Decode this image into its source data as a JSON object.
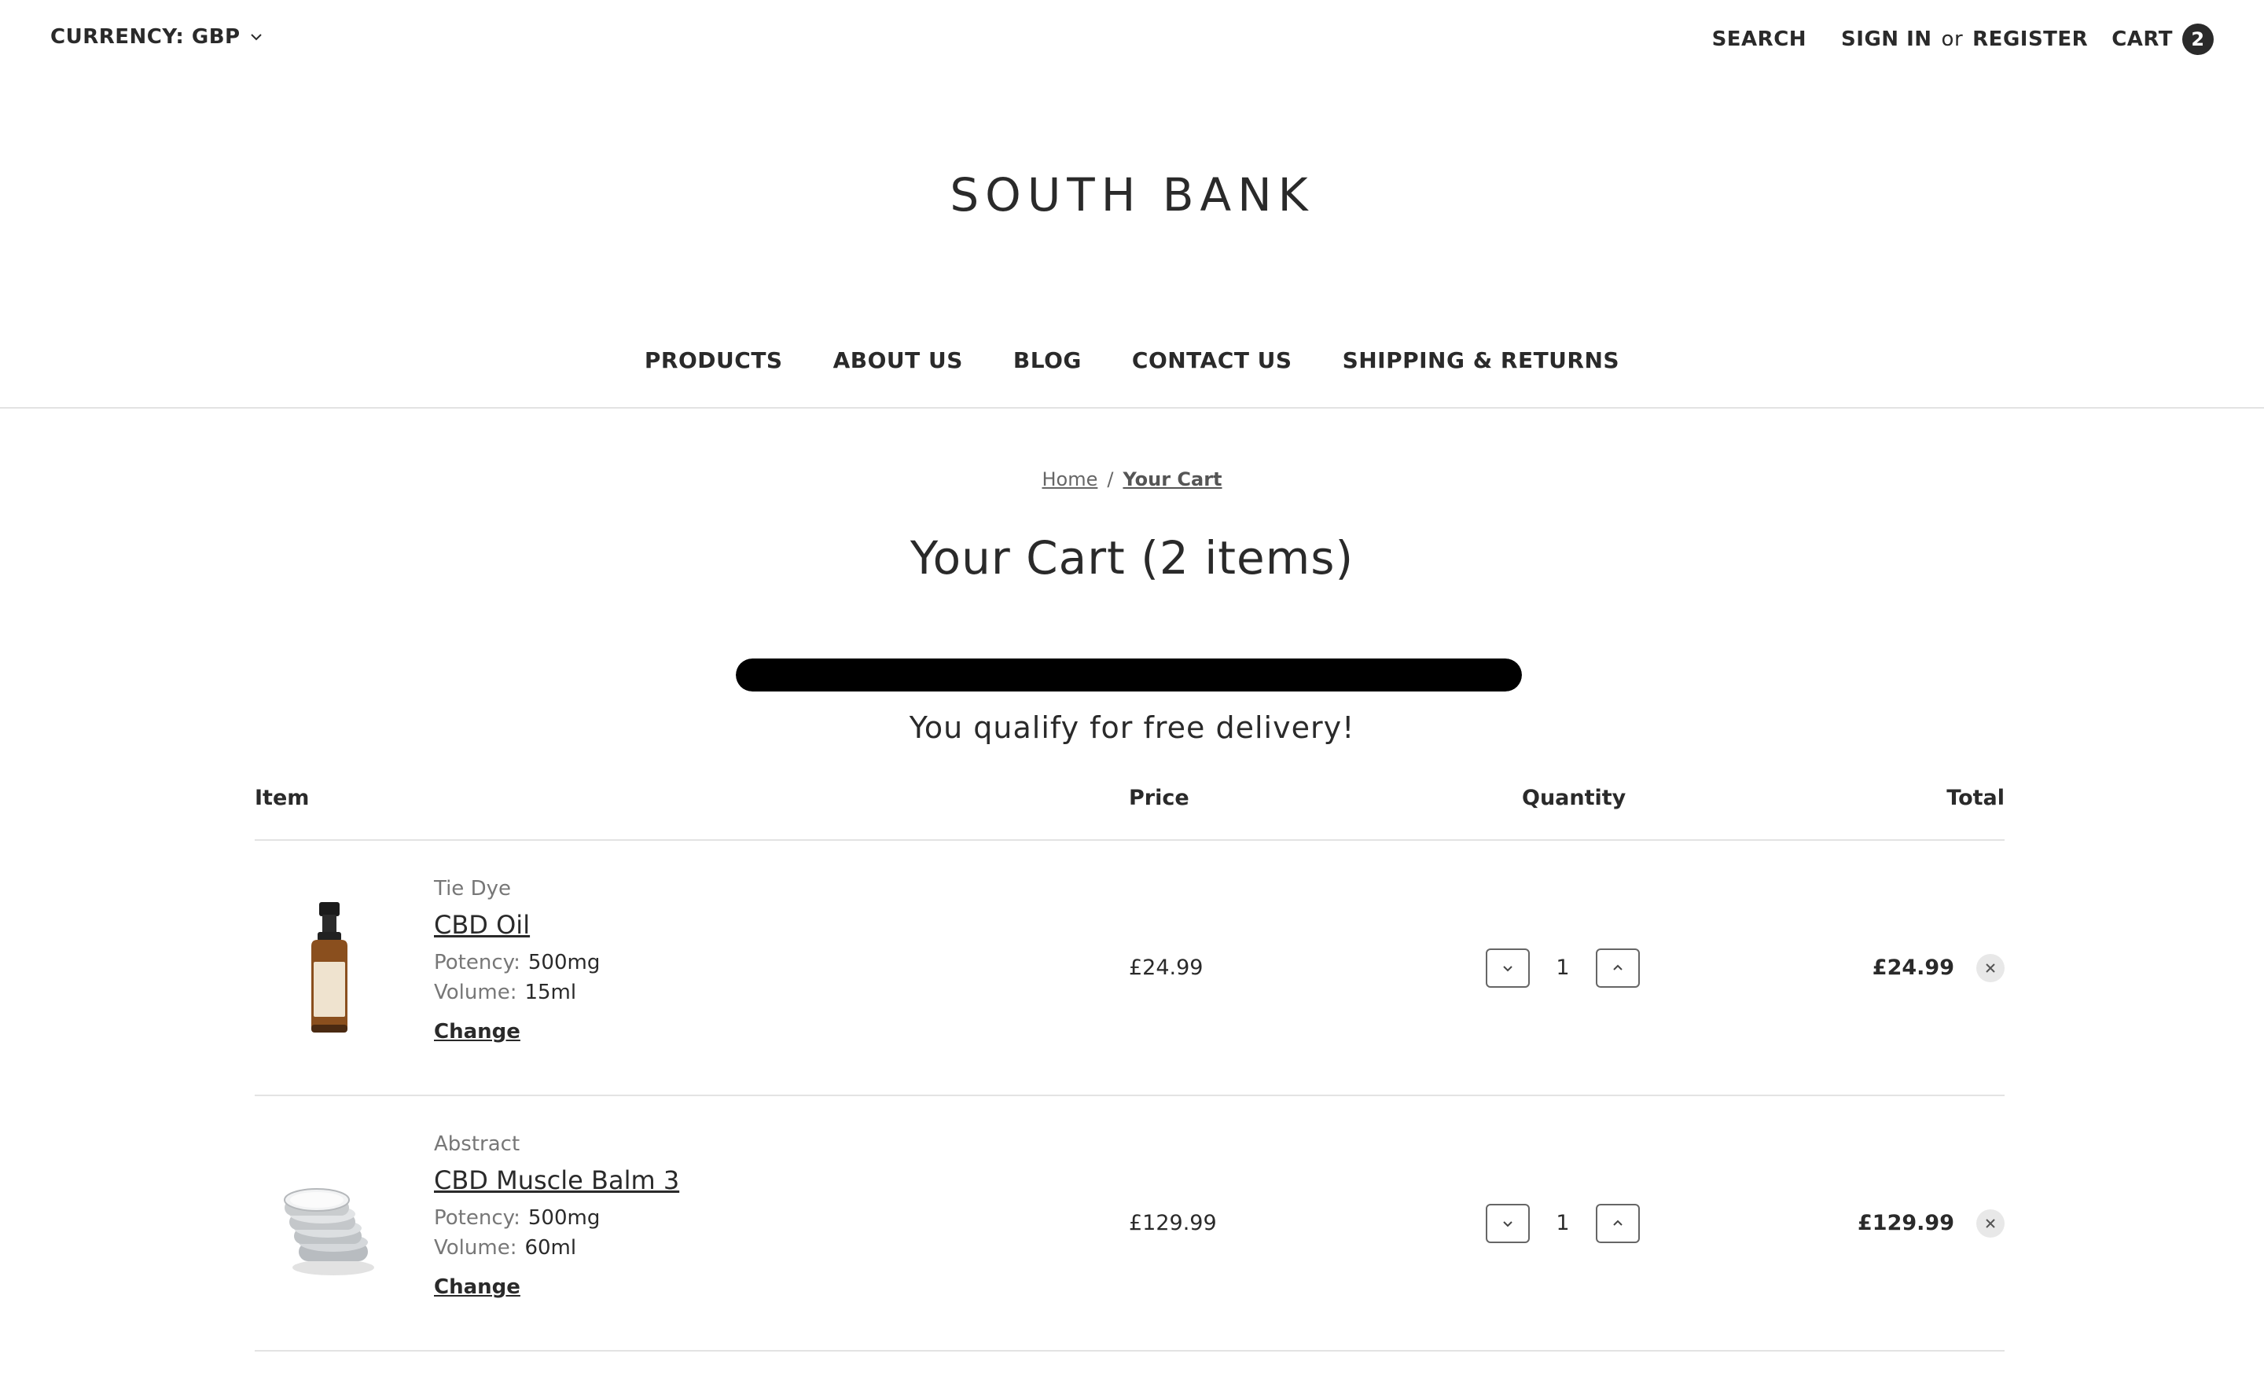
{
  "topbar": {
    "currency_label": "CURRENCY: GBP",
    "search_label": "SEARCH",
    "sign_in_label": "SIGN IN",
    "or_label": "or",
    "register_label": "REGISTER",
    "cart_label": "CART",
    "cart_count": "2"
  },
  "store": {
    "name": "SOUTH BANK"
  },
  "nav": {
    "items": [
      "PRODUCTS",
      "ABOUT US",
      "BLOG",
      "CONTACT US",
      "SHIPPING & RETURNS"
    ]
  },
  "breadcrumb": {
    "home": "Home",
    "separator": "/",
    "current": "Your Cart"
  },
  "page": {
    "title": "Your Cart (2 items)"
  },
  "delivery": {
    "message": "You qualify for free delivery!",
    "progress_percent": 100
  },
  "table": {
    "headers": {
      "item": "Item",
      "price": "Price",
      "quantity": "Quantity",
      "total": "Total"
    }
  },
  "cart_items": [
    {
      "brand": "Tie Dye",
      "name": "CBD Oil",
      "options": [
        {
          "label": "Potency:",
          "value": "500mg"
        },
        {
          "label": "Volume:",
          "value": "15ml"
        }
      ],
      "change_label": "Change",
      "price": "£24.99",
      "quantity": "1",
      "total": "£24.99"
    },
    {
      "brand": "Abstract",
      "name": "CBD Muscle Balm 3",
      "options": [
        {
          "label": "Potency:",
          "value": "500mg"
        },
        {
          "label": "Volume:",
          "value": "60ml"
        }
      ],
      "change_label": "Change",
      "price": "£129.99",
      "quantity": "1",
      "total": "£129.99"
    }
  ],
  "icons": {
    "currency_dropdown": "chevron-down-icon",
    "qty_decrease": "chevron-down-icon",
    "qty_increase": "chevron-up-icon",
    "remove": "close-icon"
  },
  "colors": {
    "text": "#2a2a2a",
    "progress_fill": "#000000",
    "divider": "#e3e3e3"
  }
}
